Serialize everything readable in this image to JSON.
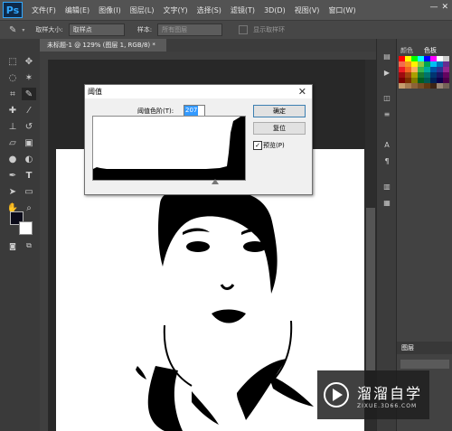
{
  "menubar": {
    "logo": "Ps",
    "items": [
      "文件(F)",
      "编辑(E)",
      "图像(I)",
      "图层(L)",
      "文字(Y)",
      "选择(S)",
      "滤镜(T)",
      "3D(D)",
      "视图(V)",
      "窗口(W)"
    ]
  },
  "options": {
    "sample_size_label": "取样大小:",
    "sample_size_value": "取样点",
    "sample_label": "样本:",
    "sample_value": "所有图层",
    "show_ring_label": "显示取样环"
  },
  "document": {
    "tab_title": "未标题-1 @ 129% (图层 1, RGB/8) *"
  },
  "dialog": {
    "title": "阈值",
    "level_label": "阈值色阶(T):",
    "level_value": "207",
    "ok_label": "确定",
    "reset_label": "复位",
    "preview_label": "预览(P)",
    "preview_checked": true
  },
  "right_panel": {
    "tab_color": "颜色",
    "tab_swatches": "色板",
    "layers_tab": "图层"
  },
  "watermark": {
    "brand": "溜溜自学",
    "url": "ZIXUE.3D66.COM"
  },
  "colors": {
    "accent": "#31a8ff",
    "foreground": "#000000",
    "background": "#ffffff"
  },
  "icons": [
    "move-icon",
    "marquee-icon",
    "lasso-icon",
    "magic-wand-icon",
    "crop-icon",
    "eyedropper-icon",
    "healing-icon",
    "brush-icon",
    "stamp-icon",
    "history-brush-icon",
    "eraser-icon",
    "gradient-icon",
    "blur-icon",
    "dodge-icon",
    "pen-icon",
    "type-icon",
    "path-select-icon",
    "shape-icon",
    "hand-icon",
    "zoom-icon"
  ]
}
